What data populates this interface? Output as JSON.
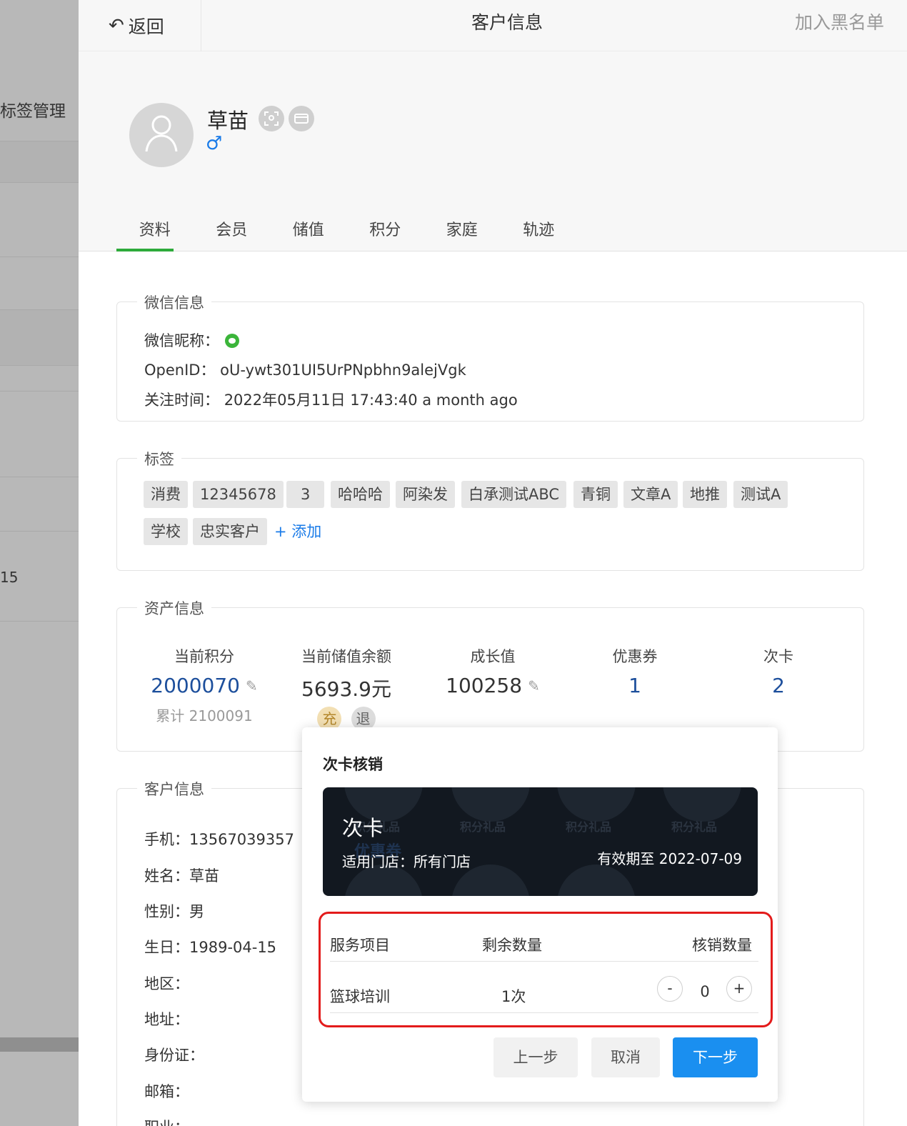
{
  "sidebar": {
    "items": [
      {
        "label": "标签管理"
      },
      {
        "label": "15"
      }
    ]
  },
  "header": {
    "back_label": "返回",
    "title": "客户信息",
    "blacklist_label": "加入黑名单"
  },
  "profile": {
    "name": "草苗",
    "gender_symbol": "♂",
    "icons": [
      "face-scan-icon",
      "card-icon"
    ]
  },
  "tabs": [
    "资料",
    "会员",
    "储值",
    "积分",
    "家庭",
    "轨迹"
  ],
  "wechat": {
    "section_title": "微信信息",
    "nickname_label": "微信昵称：",
    "openid_label": "OpenID：",
    "openid_value": "oU-ywt301UI5UrPNpbhn9alejVgk",
    "follow_label": "关注时间：",
    "follow_value": "2022年05月11日 17:43:40 a month ago"
  },
  "tags": {
    "section_title": "标签",
    "items": [
      "消费",
      "12345678",
      "3",
      "哈哈哈",
      "阿染发",
      "白承测试ABC",
      "青铜",
      "文章A",
      "地推",
      "测试A",
      "学校",
      "忠实客户"
    ],
    "add_label": "+ 添加"
  },
  "assets": {
    "section_title": "资产信息",
    "points_label": "当前积分",
    "points_value": "2000070",
    "points_total": "累计 2100091",
    "balance_label": "当前储值余额",
    "balance_value": "5693.9元",
    "recharge_label": "充",
    "refund_label": "退",
    "growth_label": "成长值",
    "growth_value": "100258",
    "coupon_label": "优惠券",
    "coupon_value": "1",
    "timecard_label": "次卡",
    "timecard_value": "2"
  },
  "customer": {
    "section_title": "客户信息",
    "fields": [
      {
        "text": "手机：13567039357"
      },
      {
        "text": "姓名：草苗"
      },
      {
        "text": "性别：男"
      },
      {
        "text": "生日：1989-04-15"
      },
      {
        "text": "地区："
      },
      {
        "text": "地址："
      },
      {
        "text": "身份证："
      },
      {
        "text": "邮箱："
      },
      {
        "text": "职业："
      }
    ]
  },
  "popover": {
    "title": "次卡核销",
    "card": {
      "name": "次卡",
      "store": "适用门店：所有门店",
      "expire": "有效期至 2022-07-09",
      "watermarks": [
        "积分礼品",
        "积分礼品",
        "积分礼品",
        "积分礼品",
        "优惠券"
      ]
    },
    "table": {
      "col_service": "服务项目",
      "col_remaining": "剩余数量",
      "col_redeem": "核销数量",
      "row": {
        "service": "篮球培训",
        "remaining": "1次",
        "redeem": "0"
      }
    },
    "stepper": {
      "minus": "-",
      "plus": "+"
    },
    "buttons": {
      "prev": "上一步",
      "cancel": "取消",
      "next": "下一步"
    }
  },
  "colors": {
    "accent_blue": "#1a8ff0",
    "tab_active": "#2daa3a",
    "highlight_red": "#e31b1b",
    "value_blue": "#1d4f9c"
  }
}
